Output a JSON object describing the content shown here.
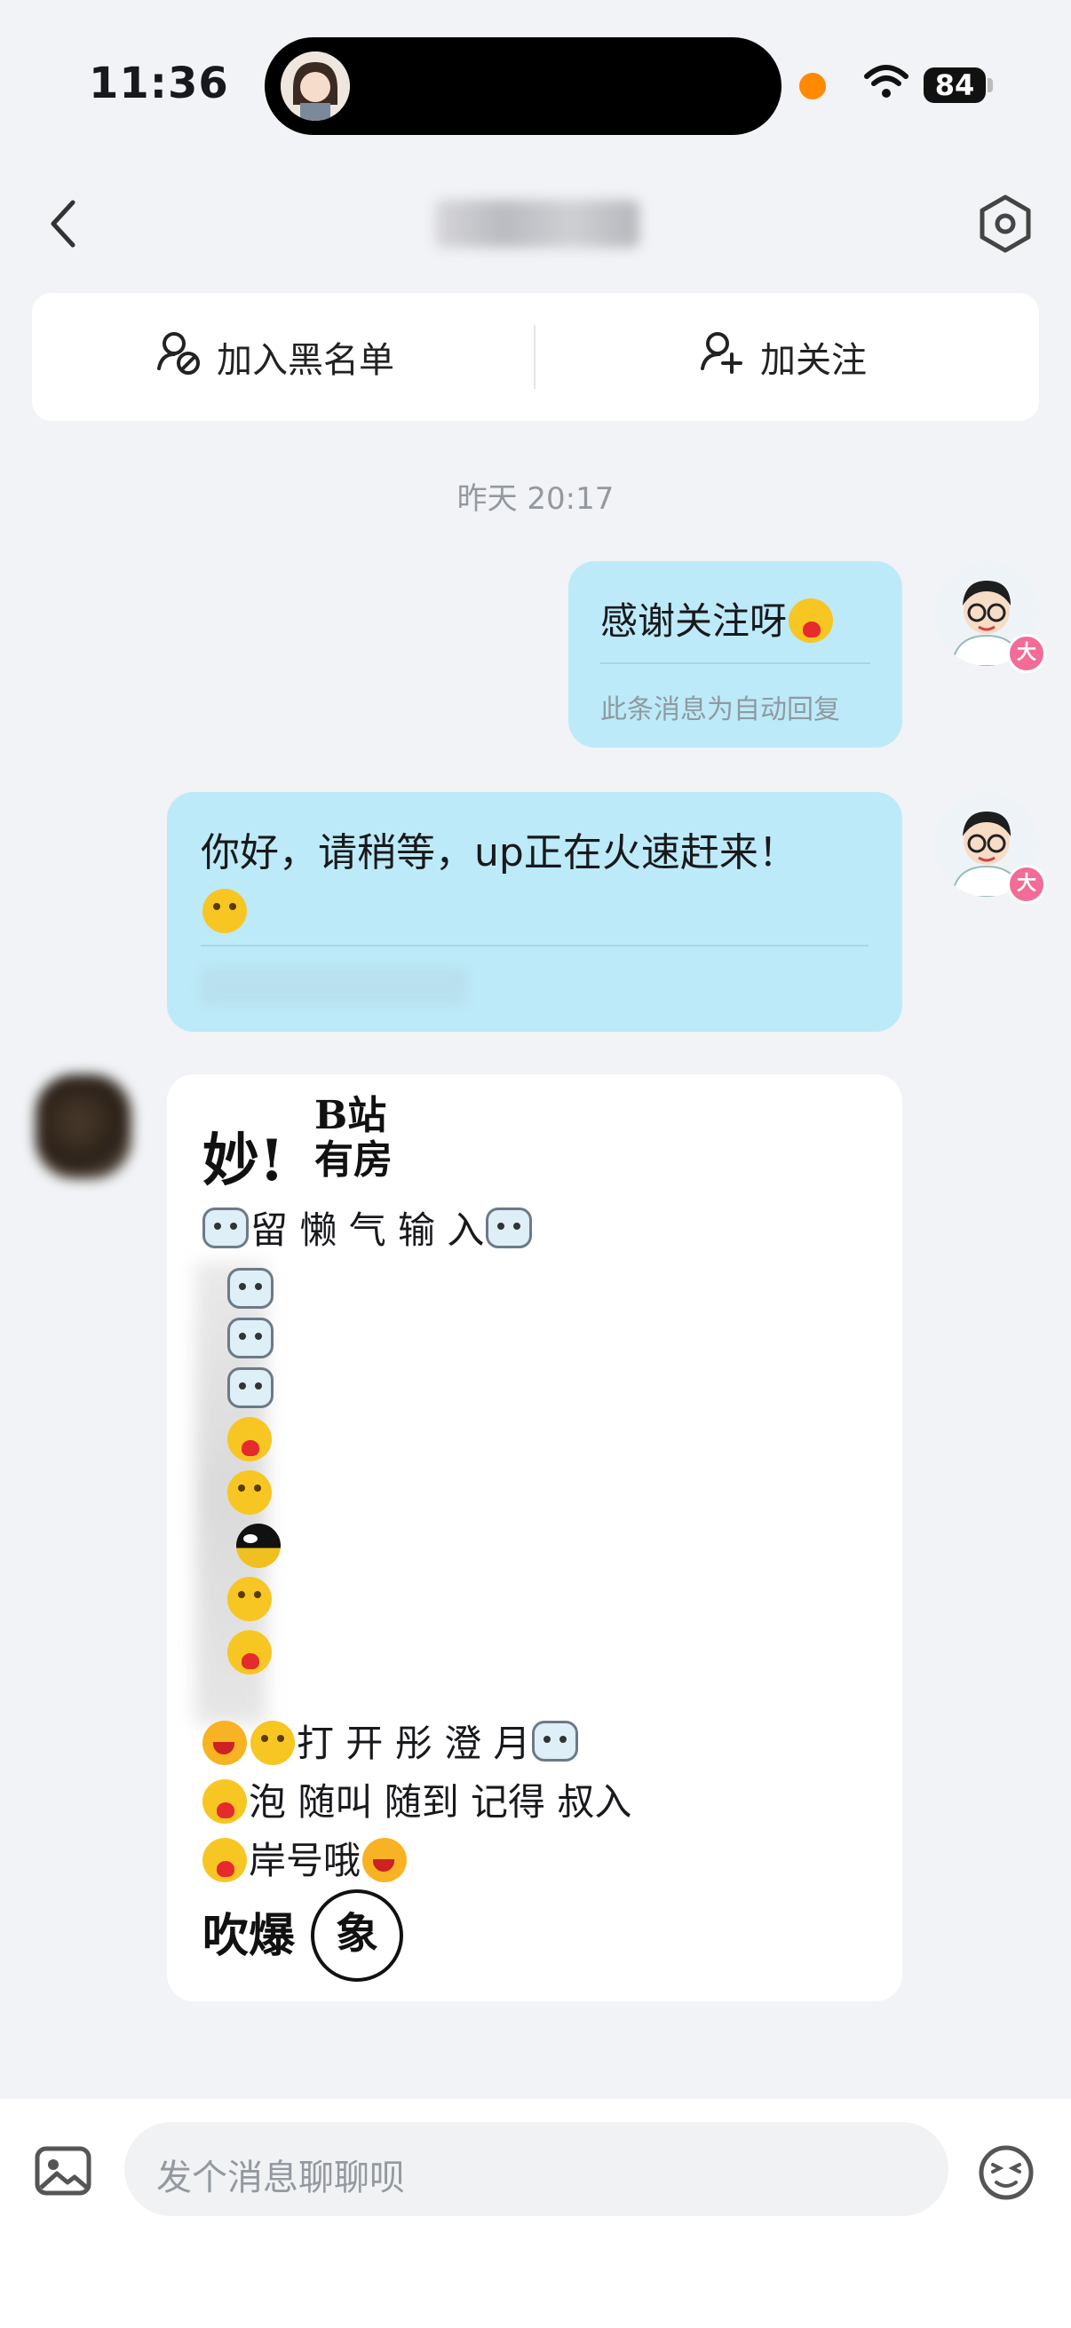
{
  "status_bar": {
    "time": "11:36",
    "battery": "84",
    "icons": [
      "recording-dot-icon",
      "wifi-icon",
      "battery-icon"
    ]
  },
  "header": {
    "back_icon": "chevron-left-icon",
    "settings_icon": "settings-hexagon-icon"
  },
  "actions": {
    "blacklist_label": "加入黑名单",
    "follow_label": "加关注",
    "blacklist_icon": "user-block-icon",
    "follow_icon": "user-add-icon"
  },
  "chat": {
    "timestamp": "昨天 20:17",
    "messages": [
      {
        "sender": "self",
        "text": "感谢关注呀",
        "note": "此条消息为自动回复",
        "badge": "大"
      },
      {
        "sender": "self",
        "text": "你好，请稍等，up正在火速赶来！",
        "badge": "大"
      },
      {
        "sender": "other",
        "sticker_top_left": "妙!",
        "sticker_top_right_1": "B站",
        "sticker_top_right_2": "有房",
        "line1": "留 懒 气 输 入",
        "line2": "打 开 彤 澄 月",
        "line3": "泡 随叫 随到 记得 叔入",
        "line4": "岸号哦",
        "sticker_bottom_left": "吹爆",
        "sticker_bottom_right": "象"
      }
    ]
  },
  "input": {
    "placeholder": "发个消息聊聊呗",
    "image_icon": "image-icon",
    "emoji_icon": "emoji-icon"
  },
  "colors": {
    "self_bubble": "#bdeaf8",
    "background": "#f1f3f6",
    "badge": "#f26c97"
  }
}
